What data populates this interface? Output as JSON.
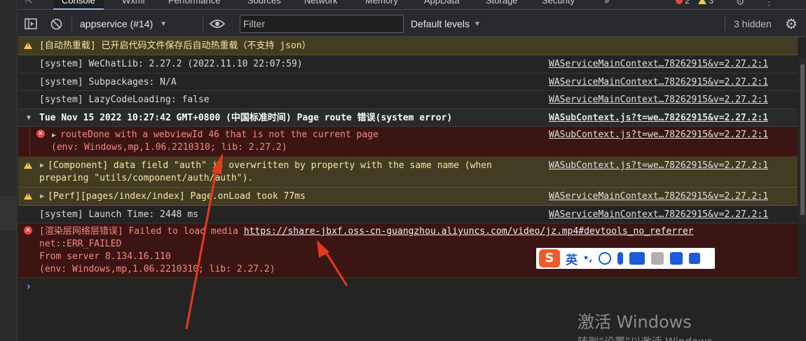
{
  "tabs": [
    "Console",
    "Wxml",
    "Performance",
    "Sources",
    "Network",
    "Memory",
    "AppData",
    "Storage",
    "Security"
  ],
  "tab_more": "»",
  "error_count": "2",
  "warning_count": "3",
  "toolbar": {
    "context": "appservice (#14)",
    "filter_placeholder": "Filter",
    "levels": "Default levels",
    "hidden": "3 hidden"
  },
  "messages": [
    {
      "type": "warn",
      "text": "[自动热重载] 已开启代码文件保存后自动热重载（不支持 json）",
      "source": ""
    },
    {
      "type": "info",
      "text": "[system] WeChatLib: 2.27.2 (2022.11.10 22:07:59)",
      "source": "WAServiceMainContext…78262915&v=2.27.2:1"
    },
    {
      "type": "info",
      "text": "[system] Subpackages: N/A",
      "source": "WAServiceMainContext…78262915&v=2.27.2:1"
    },
    {
      "type": "info",
      "text": "[system] LazyCodeLoading: false",
      "source": "WAServiceMainContext…78262915&v=2.27.2:1"
    },
    {
      "type": "group",
      "text": "Tue Nov 15 2022 10:27:42 GMT+0800 (中国标准时间) Page route 错误(system error)",
      "source": "WASubContext.js?t=we…78262915&v=2.27.2:1"
    },
    {
      "type": "error",
      "line1": "routeDone with a webviewId 46 that is not the current page",
      "line2": "(env: Windows,mp,1.06.2210310; lib: 2.27.2)",
      "source": "WASubContext.js?t=we…78262915&v=2.27.2:1"
    },
    {
      "type": "warn",
      "line1": "[Component] data field \"auth\" is overwritten by property with the same name (when",
      "line2": "preparing \"utils/component/auth/auth\").",
      "source": "WASubContext.js?t=we…78262915&v=2.27.2:1"
    },
    {
      "type": "warn",
      "text": "[Perf][pages/index/index] Page.onLoad took 77ms",
      "source": "WAServiceMainContext…78262915&v=2.27.2:1"
    },
    {
      "type": "info",
      "text": "[system] Launch Time: 2448 ms",
      "source": "WAServiceMainContext…78262915&v=2.27.2:1"
    },
    {
      "type": "error",
      "prefix": "[渲染层网络层错误] Failed to load media ",
      "link": "https://share-jbxf.oss-cn-guangzhou.aliyuncs.com/video/jz.mp4#devtools_no_referrer",
      "line2": "net::ERR_FAILED",
      "line3": "From server 8.134.16.110",
      "line4": "(env: Windows,mp,1.06.2210310; lib: 2.27.2)"
    }
  ],
  "prompt": "›",
  "ime": {
    "logo": "S",
    "mode": "英",
    "punct": "•,"
  },
  "watermark": {
    "line1": "激活 Windows",
    "line2": "转到“设置”以激活 Windows"
  },
  "colors": {
    "warn_bg": "#413c22",
    "error_bg": "#3b1414",
    "error_text": "#f28b82",
    "annotation": "#e63a1e"
  }
}
